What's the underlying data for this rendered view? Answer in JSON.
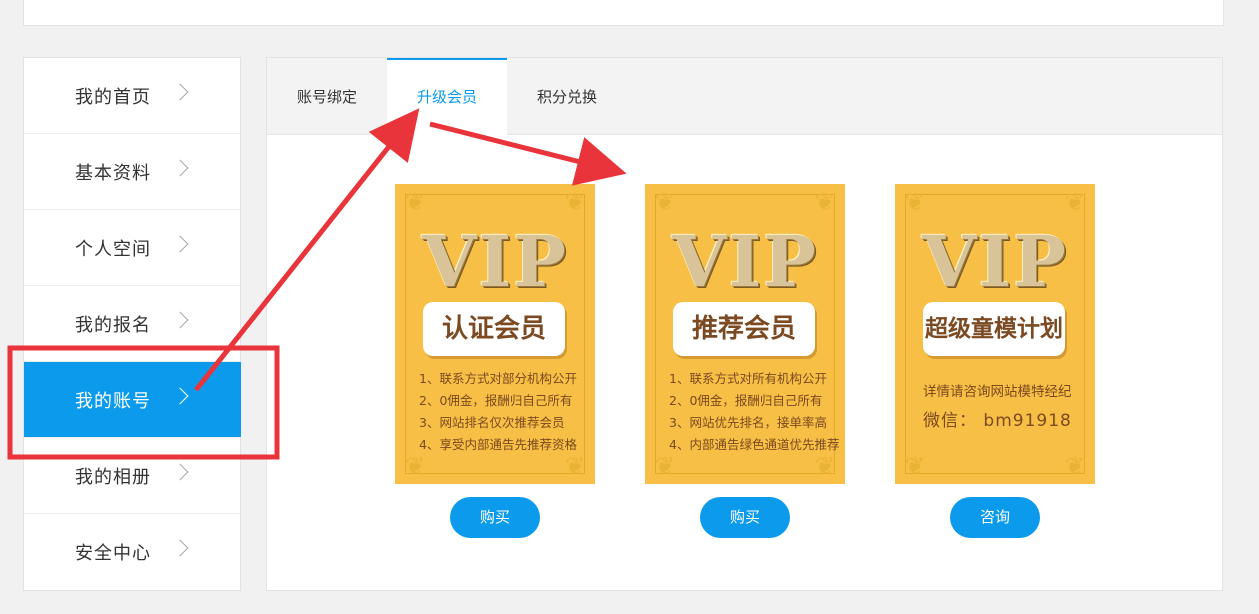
{
  "sidebar": {
    "items": [
      {
        "label": "我的首页"
      },
      {
        "label": "基本资料"
      },
      {
        "label": "个人空间"
      },
      {
        "label": "我的报名"
      },
      {
        "label": "我的账号",
        "active": true
      },
      {
        "label": "我的相册"
      },
      {
        "label": "安全中心"
      }
    ]
  },
  "tabs": [
    {
      "label": "账号绑定"
    },
    {
      "label": "升级会员",
      "active": true
    },
    {
      "label": "积分兑换"
    }
  ],
  "cards": [
    {
      "vip": "VIP",
      "title": "认证会员",
      "lines": [
        "1、联系方式对部分机构公开",
        "2、0佣金，报酬归自己所有",
        "3、网站排名仅次推荐会员",
        "4、享受内部通告先推荐资格"
      ],
      "button": "购买"
    },
    {
      "vip": "VIP",
      "title": "推荐会员",
      "lines": [
        "1、联系方式对所有机构公开",
        "2、0佣金，报酬归自己所有",
        "3、网站优先排名，接单率高",
        "4、内部通告绿色通道优先推荐"
      ],
      "button": "购买"
    },
    {
      "vip": "VIP",
      "title": "超级童模计划",
      "contact_line1": "详情请咨询网站模特经纪",
      "contact_line2": "微信：  bm91918",
      "button": "咨询"
    }
  ],
  "colors": {
    "accent": "#0c9bec",
    "card_bg": "#f7bf45",
    "annotation_red": "#e8343a"
  },
  "icons": [
    "chevron-right-icon",
    "arrow-annotation-icon",
    "corner-ornament-icon"
  ]
}
